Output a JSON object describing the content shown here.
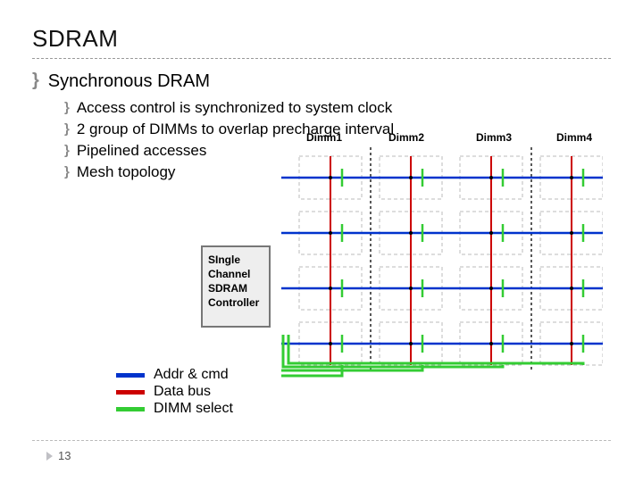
{
  "title": "SDRAM",
  "main_bullet": "Synchronous DRAM",
  "sub": {
    "b0": "Access control is synchronized to system clock",
    "b1": "2 group of DIMMs to overlap precharge interval",
    "b2": "Pipelined accesses",
    "b3": "Mesh topology"
  },
  "controller": {
    "l0": "SIngle",
    "l1": "Channel",
    "l2": "SDRAM",
    "l3": "Controller"
  },
  "dimm": {
    "c1": "Dimm1",
    "c2": "Dimm2",
    "c3": "Dimm3",
    "c4": "Dimm4"
  },
  "legend": {
    "addr": "Addr & cmd",
    "data": "Data bus",
    "sel": "DIMM select"
  },
  "page": "13"
}
